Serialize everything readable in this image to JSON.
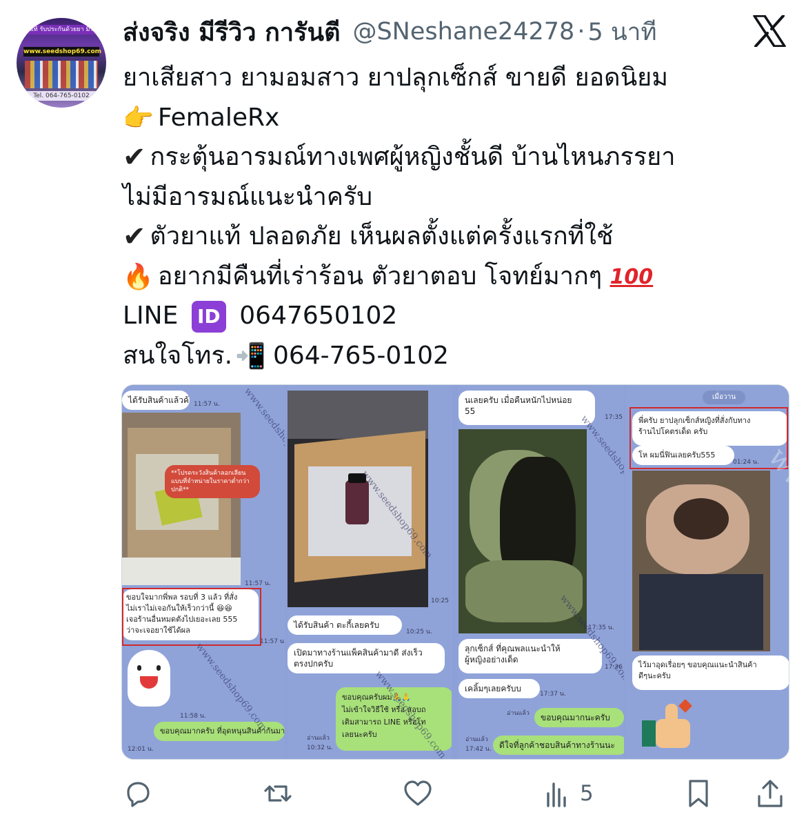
{
  "tweet": {
    "display_name": "ส่งจริง มีรีวิว การันตี",
    "handle": "@SNeshane24278",
    "separator": "·",
    "time": "5 นาที",
    "lines": [
      "ยาเสียสาว ยามอมสาว ยาปลุกเซ็กส์ ขายดี ยอดนิยม",
      "FemaleRx",
      "กระตุ้นอารมณ์ทางเพศผู้หญิงชั้นดี บ้านไหนภรรยา",
      "ไม่มีอารมณ์แนะนำครับ",
      "ตัวยาแท้ ปลอดภัย เห็นผลตั้งแต่ครั้งแรกที่ใช้",
      "อยากมีคืนที่เร่าร้อน ตัวยาตอบ โจทย์มากๆ",
      "LINE",
      "0647650102",
      "สนใจโทร.",
      "064-765-0102"
    ],
    "emoji": {
      "pointing": "👉",
      "check": "✔",
      "fire": "🔥",
      "hundred": "100",
      "id": "ID",
      "phone": "📲"
    }
  },
  "avatar": {
    "banner": "ยาแท้ รับประกันด้วยยา มีรีวิว",
    "url": "www.seedshop69.com",
    "phone": "Tel. 064-765-0102"
  },
  "media": {
    "panel1": {
      "msg_top": "ได้รับสินค้าแล้วค้าบ",
      "ts_top": "11:57 น.",
      "note": "**โปรดระวังสินค้าลอกเลียนแบบที่จำหน่ายในราคาต่ำกว่าปกติ**",
      "ts_mid": "11:57 น.",
      "msg_review_1": "ขอบใจมากพี่พล รอบที่ 3 แล้ว ที่สั่ง",
      "msg_review_2": "ไม่เราไม่เจอกันให้เร็วกว่านี้ 😆😆",
      "msg_review_3": "เจอร้านอื่นหมดตังไปเยอะเลย 555",
      "msg_review_4": "ว่าจะเจอยาใช้ได้ผล",
      "ts_review": "11:57 น.",
      "ts_sticker": "11:58 น.",
      "msg_bottom": "ขอบคุณมากครับ ที่อุดหนุนสินค้ากันมาตลอด🙏🙏",
      "ts_bottom": "12:01 น."
    },
    "panel2": {
      "ts_photo": "10:25",
      "msg_1": "ได้รับสินค้า ตะกี้เลยครับ",
      "ts_1": "10:25 น.",
      "msg_2a": "เปิดมาทางร้านแพ็คสินค้ามาดี ส่งเร็ว",
      "msg_2b": "ตรงปกครับ",
      "reply_1": "ขอบคุณครับผม🙏🙏",
      "reply_2": "ไม่เข้าใจวิธีใช้ หรือ สอบถ",
      "reply_3": "เติมสามารถ LINE หรือโท",
      "reply_4": "เลยนะครับ",
      "read": "อ่านแล้ว",
      "ts_reply": "10:32 น."
    },
    "panel3": {
      "msg_top_1": "นเลยครับ เมื่อคืนหนักไปหน่อย",
      "msg_top_2": "55",
      "ts_top": "17:35",
      "ts_photo": "17:35 น.",
      "msg_mid_1": "ลุกเซ็กส์ ที่คุณพลแนะนำให้",
      "msg_mid_2": "ผู้หญิงอย่างเด็ด",
      "ts_mid": "17:36",
      "msg_3": "เคลิ้มๆเลยครับบ",
      "ts_3": "17:37 น.",
      "reply_1": "ขอบคุณมากนะครับ",
      "read_1": "อ่านแล้ว",
      "reply_2": "ดีใจที่ลูกค้าชอบสินค้าทางร้านนะ",
      "read_2": "อ่านแล้ว",
      "ts_reply": "17:42 น."
    },
    "panel4": {
      "date": "เมื่อวาน",
      "msg_1a": "พี่ครับ ยาปลุกเซ็กส์หญิงที่สั่งกับทาง",
      "msg_1b": "ร้านไปโคตรเด็ด ครับ",
      "msg_2": "โห ผมนี่ฟินเลยครับ555",
      "ts_2": "01:24 น.",
      "msg_3a": "ไว้มาอุดเรื่อยๆ ขอบคุณแนะนำสินค้า",
      "msg_3b": "ดีๆนะครับ"
    },
    "watermark": "www.seedshop69.com"
  },
  "actions": {
    "views_count": "5"
  },
  "colors": {
    "text": "#0f1419",
    "secondary": "#536471",
    "line_bg": "#8fa3d9",
    "line_green": "#a8e07a",
    "highlight_red": "#d0282c"
  }
}
